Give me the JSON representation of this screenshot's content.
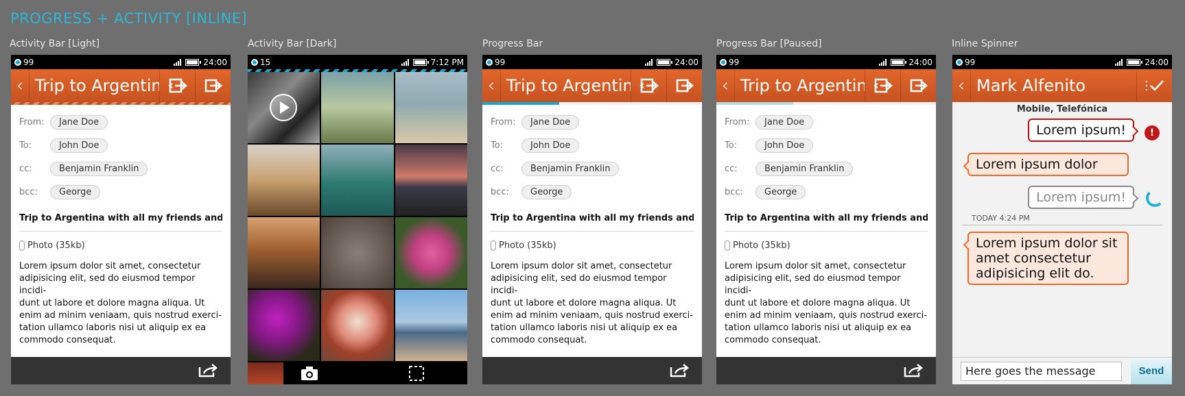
{
  "page_title": "PROGRESS + ACTIVITY [INLINE]",
  "labels": [
    "Activity Bar [Light]",
    "Activity Bar [Dark]",
    "Progress Bar",
    "Progress Bar [Paused]",
    "Inline Spinner"
  ],
  "status": {
    "count": "99",
    "time": "24:00",
    "dark_count": "15",
    "dark_time": "7:12 PM"
  },
  "email": {
    "title": "Trip to Argentin...",
    "from_label": "From:",
    "from": "Jane Doe",
    "to_label": "To:",
    "to": "John Doe",
    "cc_label": "cc:",
    "cc": "Benjamin Franklin",
    "bcc_label": "bcc:",
    "bcc": "George",
    "subject": "Trip to Argentina with all my friends and ...",
    "attachment": "Photo (35kb)",
    "body": "Lorem ipsum dolor sit amet, consectetur\nadipisicing elit, sed do eiusmod tempor incidi-\ndunt ut labore et dolore magna aliqua. Ut\nenim ad minim veniaam, quis nostrud exerci-\ntation ullamco laboris nisi ut aliquip ex ea\ncommodo consequat."
  },
  "progress": {
    "active": 0.35,
    "paused": 0.35
  },
  "icons": {
    "back": "back-chevron-icon",
    "reply_all": "reply-all-icon",
    "share": "share-icon",
    "camera": "camera-icon",
    "select": "select-icon",
    "check": "check-icon",
    "error": "error-icon"
  },
  "chat": {
    "contact": "Mark Alfenito",
    "carrier": "Mobile, Telefónica",
    "msg_error": "Lorem ipsum!",
    "msg_in_1": "Lorem ipsum dolor",
    "msg_pending": "Lorem ipsum!",
    "timestamp": "TODAY 4:24 PM",
    "msg_in_2": "Lorem ipsum dolor sit amet consectetur adipisicing elit do.",
    "error_glyph": "!",
    "input_value": "Here goes the message",
    "send": "Send"
  },
  "colors": {
    "accent": "#d95b26",
    "progress": "#18a6d1",
    "bg": "#6f6f6f"
  }
}
